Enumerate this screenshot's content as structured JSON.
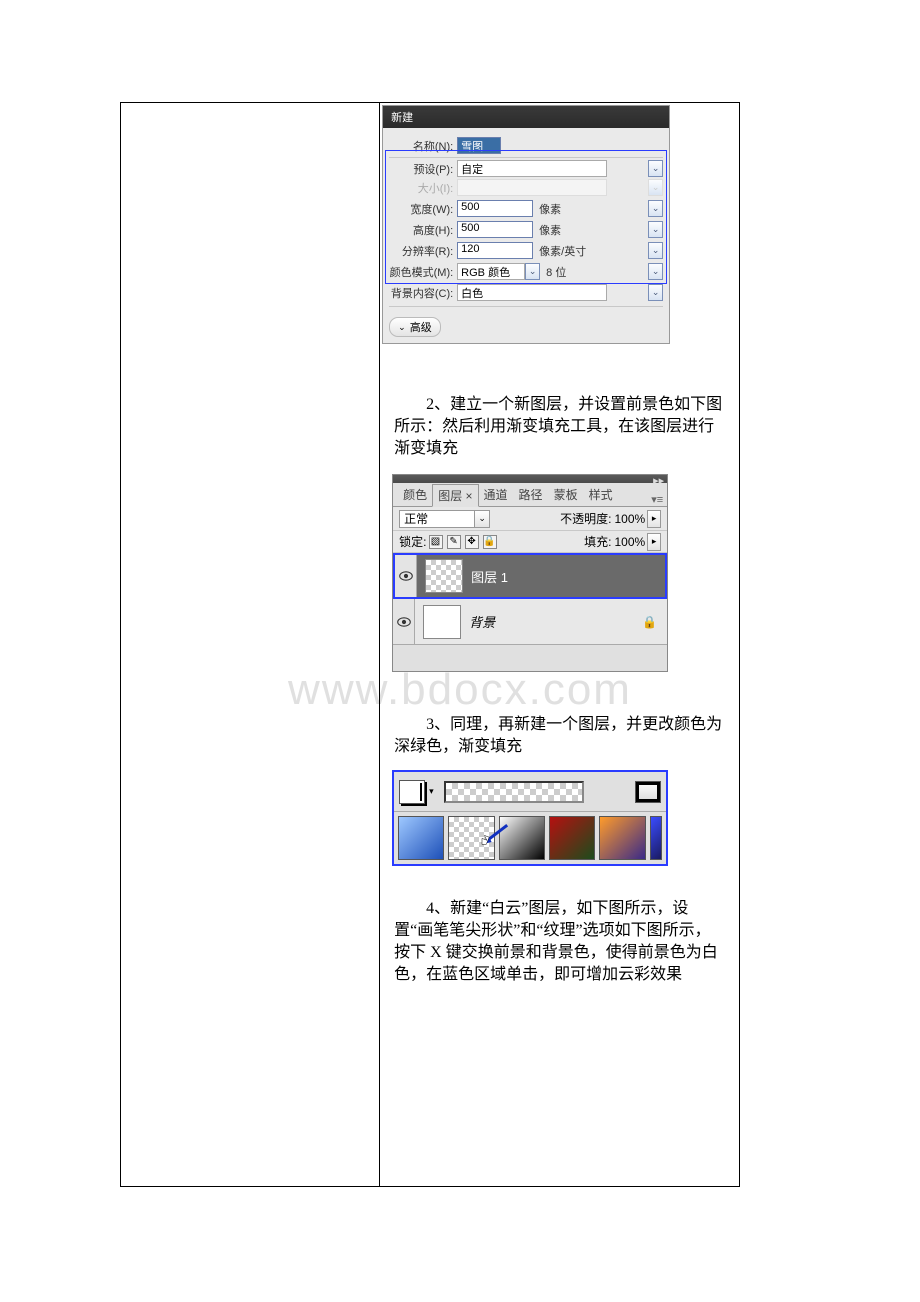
{
  "watermark": "www.bdocx.com",
  "new_dialog": {
    "title": "新建",
    "name_label": "名称(N):",
    "name_value": "雪图",
    "preset_label": "预设(P):",
    "preset_value": "自定",
    "size_label": "大小(I):",
    "width_label": "宽度(W):",
    "width_value": "500",
    "width_unit": "像素",
    "height_label": "高度(H):",
    "height_value": "500",
    "height_unit": "像素",
    "res_label": "分辨率(R):",
    "res_value": "120",
    "res_unit": "像素/英寸",
    "mode_label": "颜色模式(M):",
    "mode_value": "RGB 颜色",
    "depth_value": "8 位",
    "bg_label": "背景内容(C):",
    "bg_value": "白色",
    "advanced": "高级"
  },
  "para2": "2、建立一个新图层，并设置前景色如下图所示：然后利用渐变填充工具，在该图层进行渐变填充",
  "layers_panel": {
    "tabs": [
      "颜色",
      "图层 ×",
      "通道",
      "路径",
      "蒙板",
      "样式"
    ],
    "blend_mode": "正常",
    "opacity_label": "不透明度:",
    "opacity_value": "100%",
    "lock_label": "锁定:",
    "fill_label": "填充:",
    "fill_value": "100%",
    "layer1_name": "图层 1",
    "bg_name": "背景"
  },
  "para3": "3、同理，再新建一个图层，并更改颜色为深绿色，渐变填充",
  "para4": "4、新建“白云”图层，如下图所示，设置“画笔笔尖形状”和“纹理”选项如下图所示，按下 X 键交换前景和背景色，使得前景色为白色，在蓝色区域单击，即可增加云彩效果"
}
